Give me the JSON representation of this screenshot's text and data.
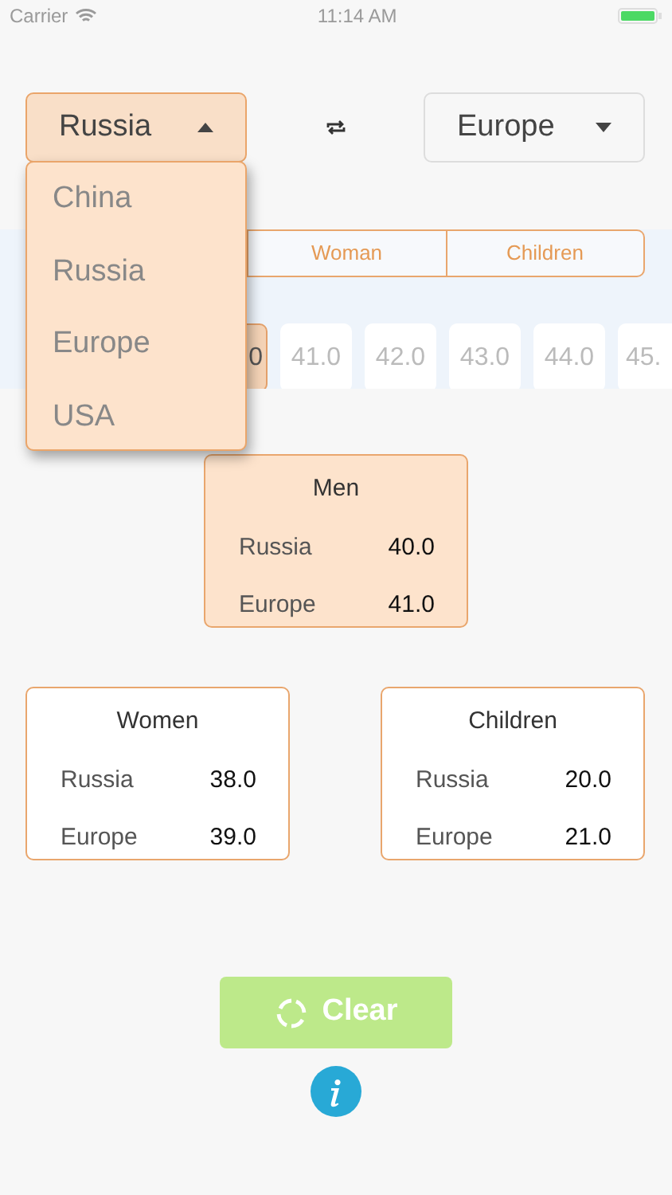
{
  "status_bar": {
    "carrier": "Carrier",
    "time": "11:14 AM"
  },
  "from_select": {
    "value": "Russia",
    "expanded": true
  },
  "to_select": {
    "value": "Europe",
    "expanded": false
  },
  "from_menu": {
    "items": [
      {
        "label": "China",
        "selected": false
      },
      {
        "label": "Russia",
        "selected": false
      },
      {
        "label": "Europe",
        "selected": false
      },
      {
        "label": "USA",
        "selected": false
      }
    ]
  },
  "gender_tabs": [
    {
      "label": "Woman",
      "selected": false
    },
    {
      "label": "Children",
      "selected": false
    }
  ],
  "sizes": [
    {
      "label": "0",
      "selected": true
    },
    {
      "label": "41.0",
      "selected": false
    },
    {
      "label": "42.0",
      "selected": false
    },
    {
      "label": "43.0",
      "selected": false
    },
    {
      "label": "44.0",
      "selected": false
    },
    {
      "label": "45.",
      "selected": false
    }
  ],
  "result_cards": [
    {
      "title": "Men",
      "highlighted": true,
      "rows": [
        {
          "region": "Russia",
          "size": "40.0"
        },
        {
          "region": "Europe",
          "size": "41.0"
        }
      ]
    },
    {
      "title": "Women",
      "highlighted": false,
      "rows": [
        {
          "region": "Russia",
          "size": "38.0"
        },
        {
          "region": "Europe",
          "size": "39.0"
        }
      ]
    },
    {
      "title": "Children",
      "highlighted": false,
      "rows": [
        {
          "region": "Russia",
          "size": "20.0"
        },
        {
          "region": "Europe",
          "size": "21.0"
        }
      ]
    }
  ],
  "clear_button": {
    "label": "Clear"
  }
}
